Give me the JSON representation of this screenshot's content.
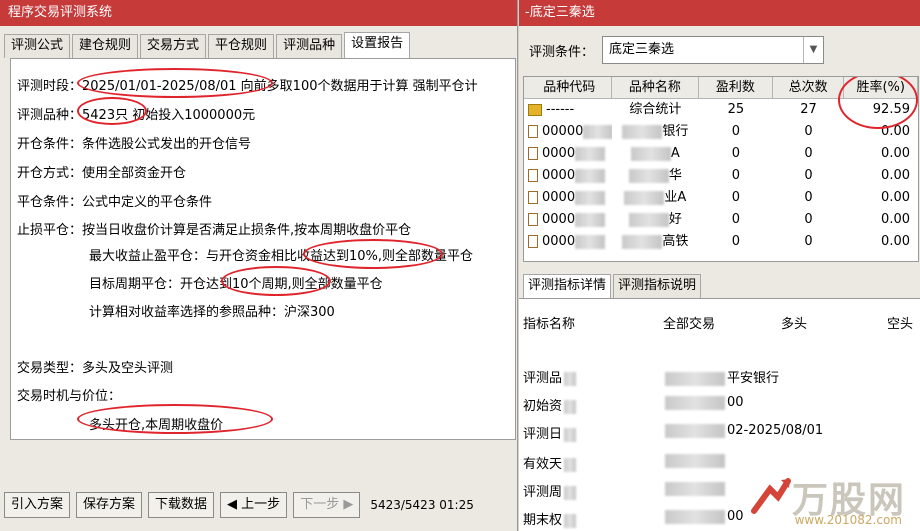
{
  "left_window": {
    "title": "程序交易评测系统",
    "tabs": [
      "评测公式",
      "建仓规则",
      "交易方式",
      "平仓规则",
      "评测品种",
      "设置报告"
    ],
    "active_tab": 5,
    "report_lines": {
      "period": "评测时段：2025/01/01-2025/08/01 向前多取100个数据用于计算 强制平仓计",
      "symbol": "评测品种：5423只 初始投入1000000元",
      "open_cond": "开仓条件：条件选股公式发出的开仓信号",
      "open_method": "开仓方式：使用全部资金开仓",
      "close_cond": "平仓条件：公式中定义的平仓条件",
      "stop_loss": "止损平仓：按当日收盘价计算是否满足止损条件,按本周期收盘价平仓",
      "max_profit": "最大收益止盈平仓：与开仓资金相比收益达到10%,则全部数量平仓",
      "target_period": "目标周期平仓：开仓达到10个周期,则全部数量平仓",
      "reference": "计算相对收益率选择的参照品种：沪深300",
      "trade_type": "交易类型：多头及空头评测",
      "timing": "交易时机与价位：",
      "timing_value": "多头开仓,本周期收盘价"
    },
    "buttons": {
      "import": "引入方案",
      "save": "保存方案",
      "download": "下载数据",
      "prev": "◀ 上一步",
      "next": "下一步 ▶"
    },
    "status": "5423/5423 01:25"
  },
  "right_window": {
    "title": "-底定三秦选",
    "condition_label": "评测条件：",
    "condition_value": "底定三秦选",
    "grid_headers": [
      "品种代码",
      "品种名称",
      "盈利数",
      "总次数",
      "胜率(%)"
    ],
    "grid_rows": [
      {
        "code": "------",
        "name": "综合统计",
        "profit": "25",
        "total": "27",
        "rate": "92.59"
      },
      {
        "code": "00000",
        "name": "银行",
        "profit": "0",
        "total": "0",
        "rate": "0.00"
      },
      {
        "code": "0000",
        "name": "A",
        "profit": "0",
        "total": "0",
        "rate": "0.00"
      },
      {
        "code": "0000",
        "name": "华",
        "profit": "0",
        "total": "0",
        "rate": "0.00"
      },
      {
        "code": "0000",
        "name": "业A",
        "profit": "0",
        "total": "0",
        "rate": "0.00"
      },
      {
        "code": "0000",
        "name": "好",
        "profit": "0",
        "total": "0",
        "rate": "0.00"
      },
      {
        "code": "0000",
        "name": "高铁",
        "profit": "0",
        "total": "0",
        "rate": "0.00"
      }
    ],
    "detail_tabs": [
      "评测指标详情",
      "评测指标说明"
    ],
    "detail_headers": [
      "指标名称",
      "全部交易",
      "多头",
      "空头"
    ],
    "detail_rows": [
      {
        "label": "评测品",
        "value": "平安银行"
      },
      {
        "label": "初始资",
        "value": "00"
      },
      {
        "label": "评测日",
        "value": "02-2025/08/01"
      },
      {
        "label": "有效天",
        "value": ""
      },
      {
        "label": "评测周",
        "value": ""
      },
      {
        "label": "期末权",
        "value": "00"
      }
    ],
    "watermark": {
      "text": "万股网",
      "url": "www.201082.com"
    }
  },
  "colors": {
    "title_bar": "#c63a3a",
    "highlight": "#e0242c"
  }
}
